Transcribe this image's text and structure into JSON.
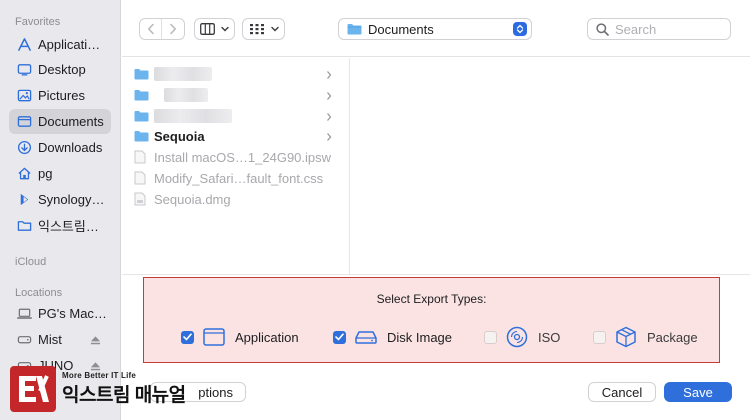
{
  "sidebar": {
    "sections": {
      "favorites": "Favorites",
      "icloud": "iCloud",
      "locations": "Locations"
    },
    "favorites": [
      {
        "label": "Applicati…",
        "icon": "applications-icon"
      },
      {
        "label": "Desktop",
        "icon": "desktop-icon"
      },
      {
        "label": "Pictures",
        "icon": "pictures-icon"
      },
      {
        "label": "Documents",
        "icon": "documents-icon",
        "selected": true
      },
      {
        "label": "Downloads",
        "icon": "downloads-icon"
      },
      {
        "label": "pg",
        "icon": "home-icon"
      },
      {
        "label": "Synology…",
        "icon": "synology-drive-icon"
      },
      {
        "label": "익스트림…",
        "icon": "folder-icon"
      }
    ],
    "locations": [
      {
        "label": "PG's Mac…",
        "icon": "laptop-icon"
      },
      {
        "label": "Mist",
        "icon": "drive-icon",
        "eject": true
      },
      {
        "label": "JUNO",
        "icon": "drive-icon",
        "eject": true
      }
    ]
  },
  "toolbar": {
    "back_icon": "chevron-left-icon",
    "forward_icon": "chevron-right-icon",
    "view_icon": "column-view-icon",
    "group_icon": "grid-view-icon",
    "location": "Documents",
    "search_placeholder": "Search"
  },
  "files": [
    {
      "name": "",
      "type": "folder",
      "redacted": true,
      "chevron": true
    },
    {
      "name": "",
      "type": "folder",
      "redacted": true,
      "chevron": true
    },
    {
      "name": "",
      "type": "folder",
      "redacted": true,
      "chevron": true
    },
    {
      "name": "Sequoia",
      "type": "folder",
      "chevron": true
    },
    {
      "name": "Install macOS…1_24G90.ipsw",
      "type": "file",
      "disabled": true
    },
    {
      "name": "Modify_Safari…fault_font.css",
      "type": "file",
      "disabled": true
    },
    {
      "name": "Sequoia.dmg",
      "type": "file",
      "disabled": true
    }
  ],
  "export": {
    "title": "Select Export Types:",
    "options": [
      {
        "label": "Application",
        "checked": true,
        "icon": "application-window-icon"
      },
      {
        "label": "Disk Image",
        "checked": true,
        "icon": "disk-drive-icon"
      },
      {
        "label": "ISO",
        "checked": false,
        "icon": "optical-disc-icon"
      },
      {
        "label": "Package",
        "checked": false,
        "icon": "package-box-icon"
      }
    ]
  },
  "buttons": {
    "options": "ptions",
    "cancel": "Cancel",
    "save": "Save"
  },
  "watermark": {
    "tagline": "More Better IT Life",
    "brand": "익스트림 매뉴얼"
  },
  "colors": {
    "accent": "#2f6fdc",
    "highlight_border": "#c63b3b",
    "highlight_fill": "#fbe3e3",
    "watermark_red": "#c4272a"
  }
}
